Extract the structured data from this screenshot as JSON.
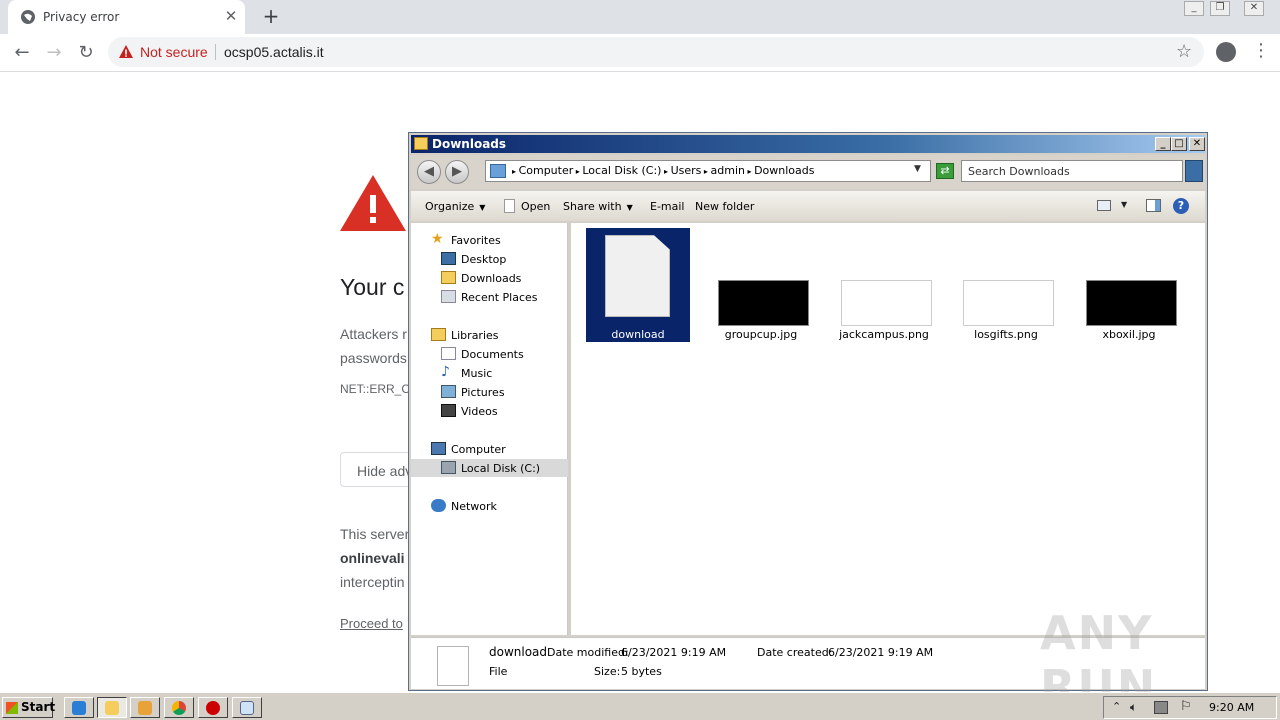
{
  "browser": {
    "tab_title": "Privacy error",
    "not_secure": "Not secure",
    "url": "ocsp05.actalis.it"
  },
  "error_page": {
    "title": "Your c",
    "p1_line1": "Attackers r",
    "p1_line2": "passwords",
    "code": "NET::ERR_Cl",
    "hide_button": "Hide adv",
    "p2_line1": "This server",
    "p2_line2": "onlinevali",
    "p2_line3": "interceptin",
    "proceed": "Proceed to"
  },
  "explorer": {
    "title": "Downloads",
    "breadcrumbs": [
      "Computer",
      "Local Disk (C:)",
      "Users",
      "admin",
      "Downloads"
    ],
    "search_placeholder": "Search Downloads",
    "commands": {
      "organize": "Organize",
      "open": "Open",
      "share_with": "Share with",
      "email": "E-mail",
      "new_folder": "New folder"
    },
    "nav": {
      "favorites": "Favorites",
      "desktop": "Desktop",
      "downloads": "Downloads",
      "recent": "Recent Places",
      "libraries": "Libraries",
      "documents": "Documents",
      "music": "Music",
      "pictures": "Pictures",
      "videos": "Videos",
      "computer": "Computer",
      "local_disk": "Local Disk (C:)",
      "network": "Network"
    },
    "files": [
      {
        "name": "download"
      },
      {
        "name": "groupcup.jpg"
      },
      {
        "name": "jackcampus.png"
      },
      {
        "name": "losgifts.png"
      },
      {
        "name": "xboxil.jpg"
      }
    ],
    "details": {
      "name": "download",
      "type": "File",
      "modified_label": "Date modified:",
      "modified_value": "6/23/2021 9:19 AM",
      "created_label": "Date created:",
      "created_value": "6/23/2021 9:19 AM",
      "size_label": "Size:",
      "size_value": "5 bytes"
    }
  },
  "taskbar": {
    "start": "Start",
    "clock": "9:20 AM"
  },
  "watermark": "ANY RUN"
}
